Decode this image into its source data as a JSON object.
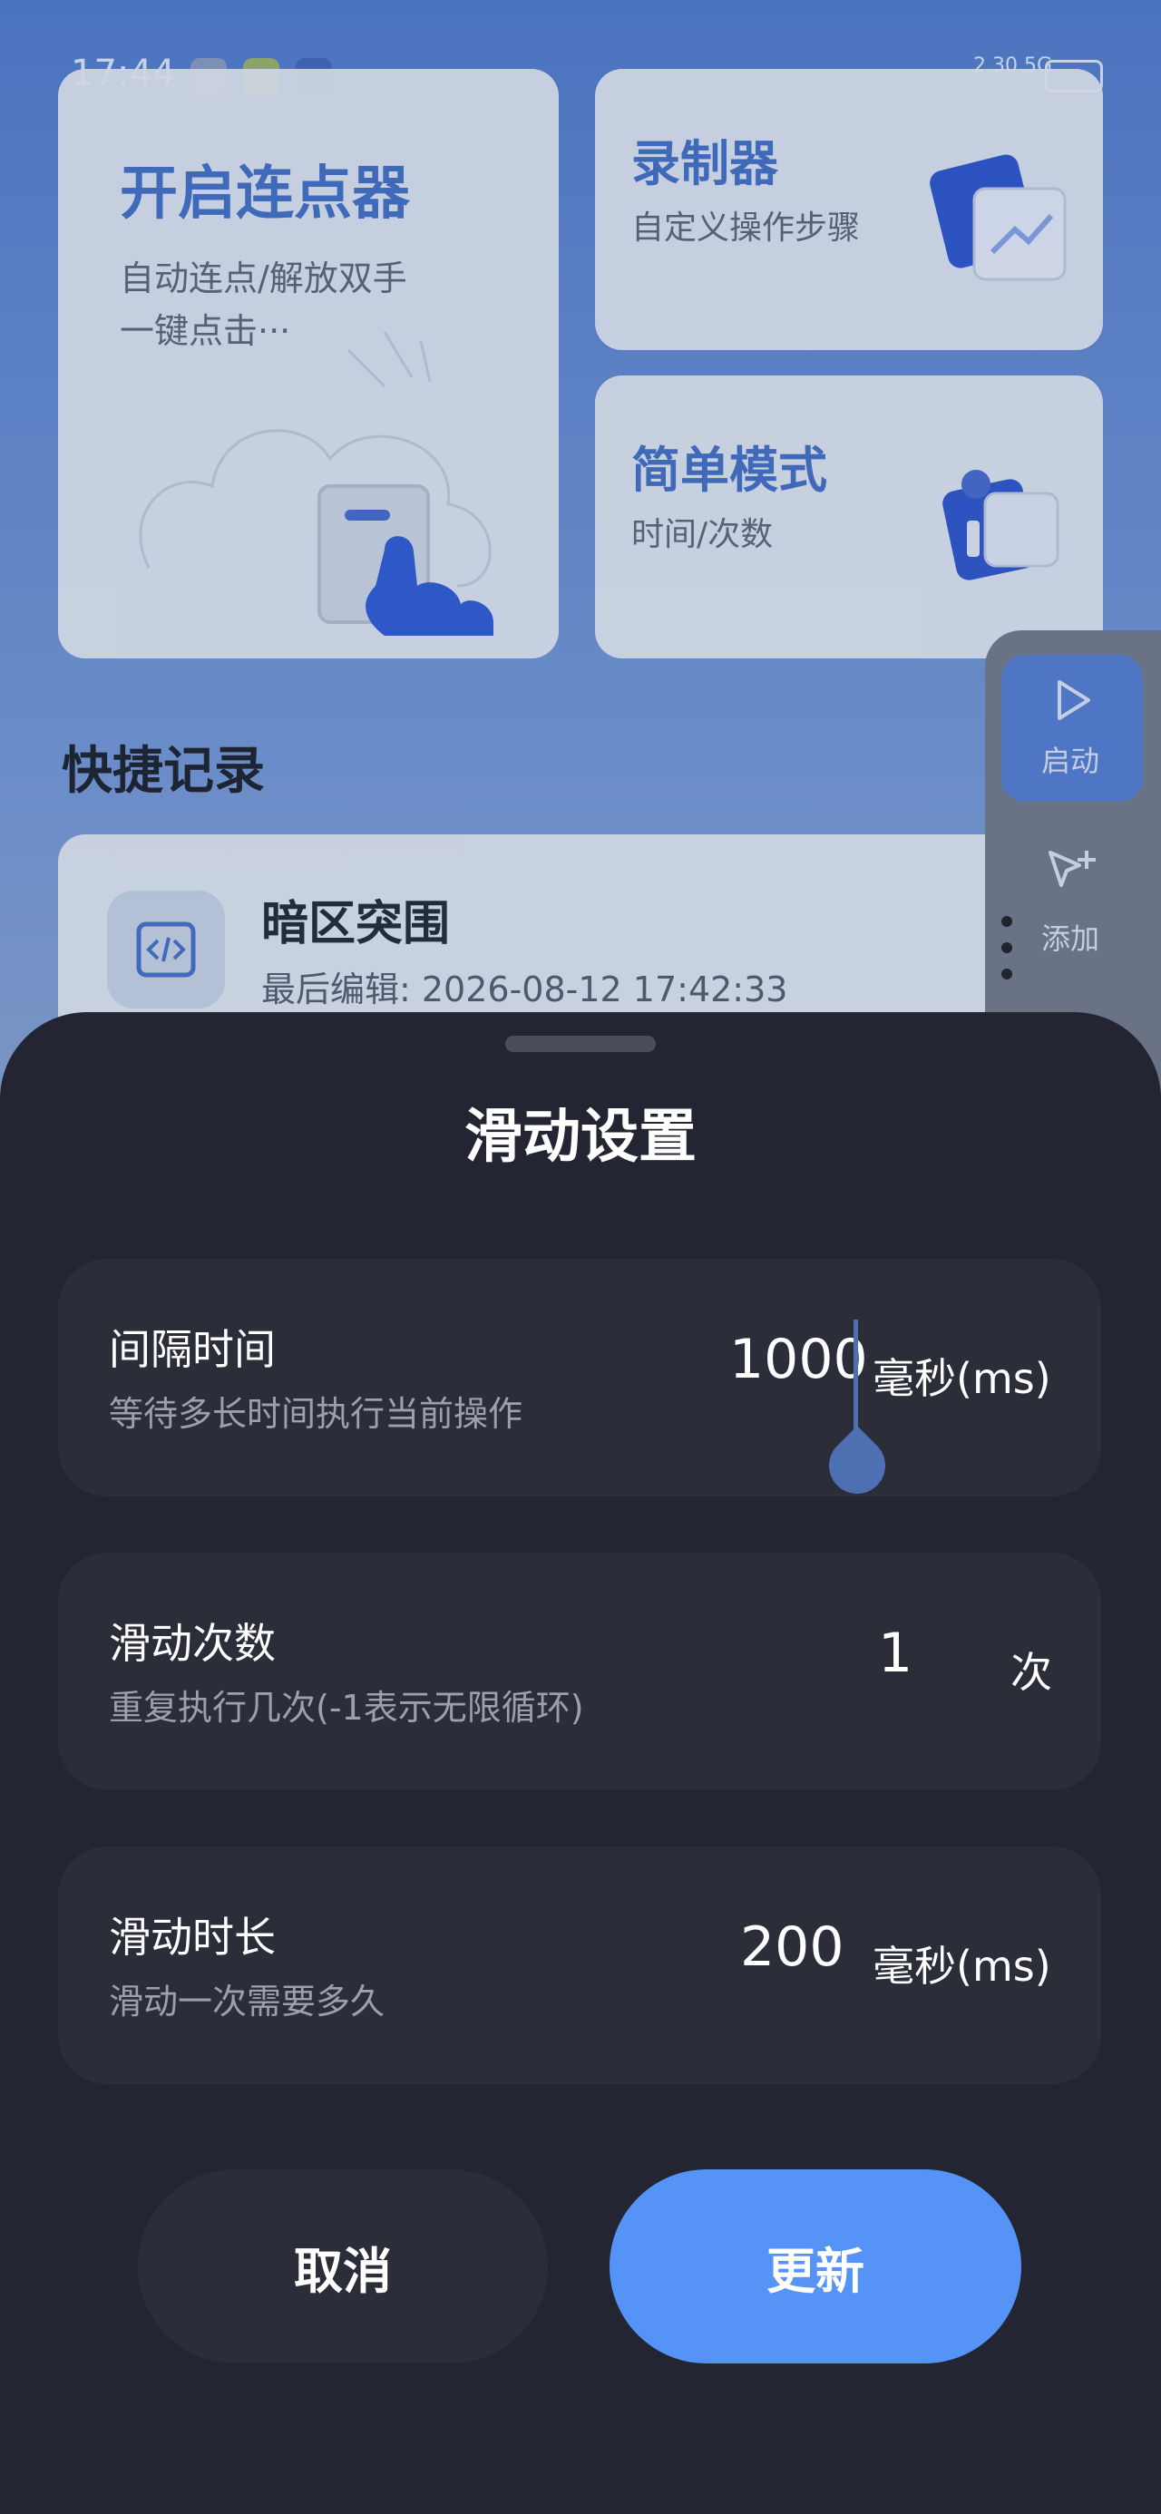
{
  "status_bar": {
    "time": "17:44",
    "network": "2.30 5G"
  },
  "cards": {
    "auto_clicker": {
      "title": "开启连点器",
      "line1": "自动连点/解放双手",
      "line2": "一键点击···"
    },
    "recorder": {
      "title": "录制器",
      "subtitle": "自定义操作步骤"
    },
    "simple_mode": {
      "title": "简单模式",
      "subtitle": "时间/次数"
    }
  },
  "quick_records": {
    "section_title": "快捷记录",
    "items": [
      {
        "name": "暗区突围",
        "last_edit": "最后编辑: 2026-08-12 17:42:33"
      }
    ]
  },
  "floating_panel": {
    "start_label": "启动",
    "add_label": "添加"
  },
  "sheet": {
    "title": "滑动设置",
    "settings": [
      {
        "title": "间隔时间",
        "desc": "等待多长时间执行当前操作",
        "value": "1000",
        "unit": "毫秒(ms)"
      },
      {
        "title": "滑动次数",
        "desc": "重复执行几次(-1表示无限循环)",
        "value": "1",
        "unit": "次"
      },
      {
        "title": "滑动时长",
        "desc": "滑动一次需要多久",
        "value": "200",
        "unit": "毫秒(ms)"
      }
    ],
    "cancel_label": "取消",
    "update_label": "更新"
  },
  "colors": {
    "accent": "#5593F7",
    "sheet_bg": "#232632",
    "row_bg": "#2B2E39",
    "card_title": "#3E68B9"
  },
  "icons": [
    "code-icon",
    "play-icon",
    "add-cursor-icon",
    "more-vertical-icon",
    "hand-pointer-icon",
    "chart-image-icon",
    "edit-illustration-icon"
  ]
}
